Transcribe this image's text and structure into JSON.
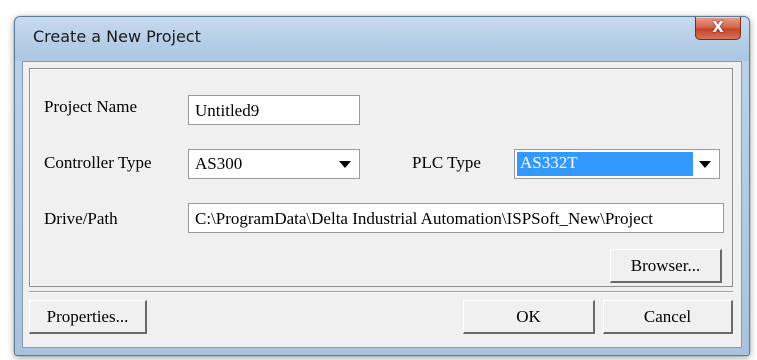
{
  "window": {
    "title": "Create a New Project",
    "close_glyph": "X"
  },
  "form": {
    "project_name_label": "Project Name",
    "project_name_value": "Untitled9",
    "controller_type_label": "Controller Type",
    "controller_type_value": "AS300",
    "plc_type_label": "PLC Type",
    "plc_type_value": "AS332T",
    "drive_path_label": "Drive/Path",
    "drive_path_value": "C:\\ProgramData\\Delta Industrial Automation\\ISPSoft_New\\Project",
    "browser_button": "Browser..."
  },
  "footer": {
    "properties_button": "Properties...",
    "ok_button": "OK",
    "cancel_button": "Cancel"
  },
  "colors": {
    "selection": "#3399ff",
    "close_button": "#c5442a",
    "title_bar": "#b6cde6"
  }
}
